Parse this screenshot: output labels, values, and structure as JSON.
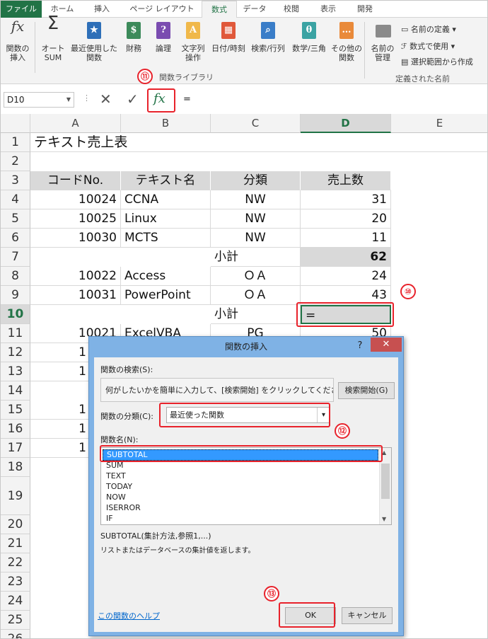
{
  "ribbon_tabs": [
    "ファイル",
    "ホーム",
    "挿入",
    "ページ レイアウト",
    "数式",
    "データ",
    "校閲",
    "表示",
    "開発"
  ],
  "ribbon": {
    "insert_function": "関数の\n挿入",
    "autosum": "オート\nSUM",
    "recent": "最近使用した\n関数",
    "financial": "財務",
    "logical": "論理",
    "text": "文字列\n操作",
    "datetime": "日付/時刻",
    "lookup": "検索/行列",
    "math": "数学/三角",
    "more": "その他の\n関数",
    "name_manager": "名前の\n管理",
    "define_name": "名前の定義",
    "use_in_formula": "数式で使用",
    "create_from_selection": "選択範囲から作成",
    "group_function_library": "関数ライブラリ",
    "group_defined_names": "定義された名前"
  },
  "formula_bar": {
    "name_box": "D10",
    "cancel": "✕",
    "enter": "✓",
    "fx": "fx",
    "formula": "="
  },
  "columns": [
    "A",
    "B",
    "C",
    "D",
    "E"
  ],
  "rows": [
    "1",
    "2",
    "3",
    "4",
    "5",
    "6",
    "7",
    "8",
    "9",
    "10",
    "11",
    "12",
    "13",
    "14",
    "15",
    "16",
    "17",
    "18",
    "19",
    "20",
    "21",
    "22",
    "23",
    "24",
    "25",
    "26"
  ],
  "sheet": {
    "title": "テキスト売上表",
    "headers": [
      "コードNo.",
      "テキスト名",
      "分類",
      "売上数"
    ],
    "r4": [
      "10024",
      "CCNA",
      "NW",
      "31"
    ],
    "r5": [
      "10025",
      "Linux",
      "NW",
      "20"
    ],
    "r6": [
      "10030",
      "MCTS",
      "NW",
      "11"
    ],
    "r7": [
      "",
      "",
      "小計",
      "62"
    ],
    "r8": [
      "10022",
      "Access",
      "ＯＡ",
      "24"
    ],
    "r9": [
      "10031",
      "PowerPoint",
      "ＯＡ",
      "43"
    ],
    "r10": [
      "",
      "",
      "小計",
      "="
    ],
    "r11": [
      "10021",
      "ExcelVBA",
      "PG",
      "50"
    ],
    "r12": [
      "1",
      "",
      "",
      ""
    ],
    "r13": [
      "1",
      "",
      "",
      ""
    ],
    "r15": [
      "1",
      "",
      "",
      ""
    ],
    "r16": [
      "1",
      "",
      "",
      ""
    ],
    "r17": [
      "1",
      "",
      "",
      ""
    ]
  },
  "markers": {
    "m10": "⑩",
    "m11": "⑪",
    "m12": "⑫",
    "m13": "⑬"
  },
  "dialog": {
    "title": "関数の挿入",
    "help_glyph": "?",
    "close_glyph": "✕",
    "search_label": "関数の検索(S):",
    "search_value": "何がしたいかを簡単に入力して、[検索開始] をクリックしてください。",
    "search_button": "検索開始(G)",
    "category_label": "関数の分類(C):",
    "category_value": "最近使った関数",
    "name_label": "関数名(N):",
    "functions": [
      "SUBTOTAL",
      "SUM",
      "TEXT",
      "TODAY",
      "NOW",
      "ISERROR",
      "IF"
    ],
    "syntax": "SUBTOTAL(集計方法,参照1,...)",
    "description": "リストまたはデータベースの集計値を返します。",
    "help_link": "この関数のヘルプ",
    "ok": "OK",
    "cancel": "キャンセル"
  },
  "colors": {
    "excel_green": "#217346",
    "marker_red": "#e8222b",
    "selection_blue": "#3399ff",
    "dialog_frame": "#7fb2e5"
  }
}
